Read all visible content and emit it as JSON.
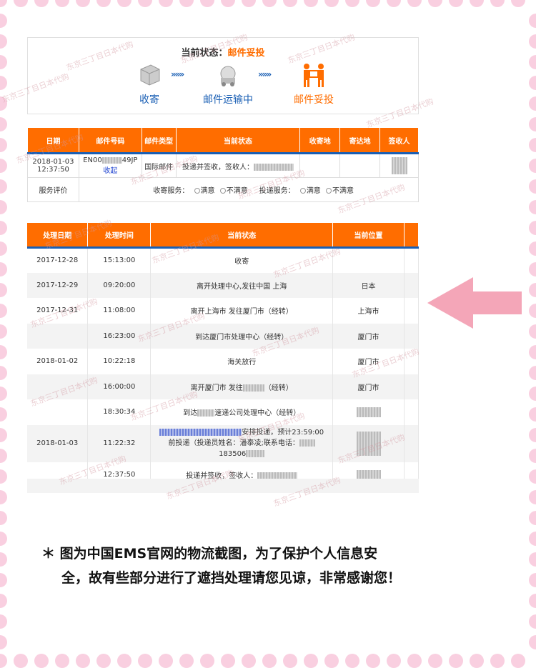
{
  "status": {
    "label": "当前状态：",
    "value": "邮件妥投",
    "steps": [
      "收寄",
      "邮件运输中",
      "邮件妥投"
    ],
    "arrow": "»»»"
  },
  "summary_table": {
    "headers": [
      "日期",
      "邮件号码",
      "邮件类型",
      "当前状态",
      "收寄地",
      "寄达地",
      "签收人"
    ],
    "row": {
      "date": "2018-01-03 12:37:50",
      "tracking_prefix": "EN00",
      "tracking_suffix": "49JP",
      "collapse_link": "收起",
      "mail_type": "国际邮件",
      "status": "投递并签收，签收人："
    },
    "rating": {
      "label": "服务评价",
      "collect_label": "收寄服务：",
      "deliver_label": "投递服务：",
      "satisfied": "满意",
      "unsatisfied": "不满意"
    }
  },
  "detail_table": {
    "headers": [
      "处理日期",
      "处理时间",
      "当前状态",
      "当前位置"
    ],
    "rows": [
      {
        "date": "2017-12-28",
        "time": "15:13:00",
        "status": "收寄",
        "location": ""
      },
      {
        "date": "2017-12-29",
        "time": "09:20:00",
        "status": "离开处理中心,发往中国 上海",
        "location": "日本"
      },
      {
        "date": "2017-12-31",
        "time": "11:08:00",
        "status": "离开上海市 发往厦门市（经转）",
        "location": "上海市"
      },
      {
        "date": "",
        "time": "16:23:00",
        "status": "到达厦门市处理中心（经转）",
        "location": "厦门市"
      },
      {
        "date": "2018-01-02",
        "time": "10:22:18",
        "status": "海关放行",
        "location": "厦门市"
      },
      {
        "date": "",
        "time": "16:00:00",
        "status": "离开厦门市 发往",
        "status_suffix": "（经转）",
        "location": "厦门市"
      },
      {
        "date": "",
        "time": "18:30:34",
        "status": "到达",
        "status_suffix": "速递公司处理中心（经转）",
        "location": ""
      },
      {
        "date": "2018-01-03",
        "time": "11:22:32",
        "status": "安排投递，预计23:59:00",
        "status_line2": "前投递（投递员姓名：潘泰凌;联系电话：",
        "status_line3": "183506",
        "location": ""
      },
      {
        "date": "",
        "time": "12:37:50",
        "status": "投递并签收，签收人：",
        "location": ""
      }
    ]
  },
  "watermark": "东京三丁目日本代购",
  "note": {
    "line1": "＊ 图为中国EMS官网的物流截图，为了保护个人信息安",
    "line2": "全，故有些部分进行了遮挡处理请您见谅，非常感谢您！"
  },
  "colors": {
    "accent": "#ff6d00",
    "header_rule": "#1a5fb4",
    "pink_arrow": "#f4a6b8",
    "dots": "#f9cfe0"
  }
}
